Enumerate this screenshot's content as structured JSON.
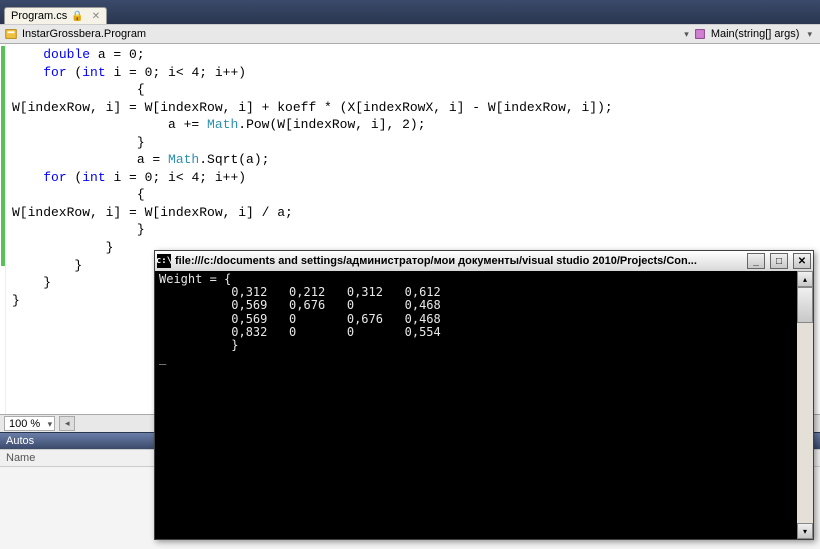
{
  "tab": {
    "label": "Program.cs",
    "locked": true
  },
  "breadcrumb": {
    "namespace": "InstarGrossbera.Program",
    "method": "Main(string[] args)"
  },
  "code": {
    "lines": [
      {
        "indent": 1,
        "tokens": [
          [
            "kw",
            "double"
          ],
          [
            "",
            " a = 0;"
          ]
        ]
      },
      {
        "indent": 1,
        "tokens": [
          [
            "kw",
            "for"
          ],
          [
            "",
            " ("
          ],
          [
            "kw",
            "int"
          ],
          [
            "",
            " i = 0; i< 4; i++)"
          ]
        ]
      },
      {
        "indent": 4,
        "tokens": [
          [
            "",
            "{"
          ]
        ]
      },
      {
        "indent": 0,
        "tokens": [
          [
            "",
            "W[indexRow, i] = W[indexRow, i] + koeff * (X[indexRowX, i] - W[indexRow, i]);"
          ]
        ]
      },
      {
        "indent": 5,
        "tokens": [
          [
            "",
            "a += "
          ],
          [
            "cls",
            "Math"
          ],
          [
            "",
            ".Pow(W[indexRow, i], 2);"
          ]
        ]
      },
      {
        "indent": 4,
        "tokens": [
          [
            "",
            "}"
          ]
        ]
      },
      {
        "indent": 4,
        "tokens": [
          [
            "",
            "a = "
          ],
          [
            "cls",
            "Math"
          ],
          [
            "",
            ".Sqrt(a);"
          ]
        ]
      },
      {
        "indent": 1,
        "tokens": [
          [
            "kw",
            "for"
          ],
          [
            "",
            " ("
          ],
          [
            "kw",
            "int"
          ],
          [
            "",
            " i = 0; i< 4; i++)"
          ]
        ]
      },
      {
        "indent": 4,
        "tokens": [
          [
            "",
            "{"
          ]
        ]
      },
      {
        "indent": 0,
        "tokens": [
          [
            "",
            "W[indexRow, i] = W[indexRow, i] / a;"
          ]
        ]
      },
      {
        "indent": 4,
        "tokens": [
          [
            "",
            "}"
          ]
        ]
      },
      {
        "indent": 3,
        "tokens": [
          [
            "",
            "}"
          ]
        ]
      },
      {
        "indent": 2,
        "tokens": [
          [
            "",
            "}"
          ]
        ]
      },
      {
        "indent": 1,
        "tokens": [
          [
            "",
            "}"
          ]
        ]
      },
      {
        "indent": 0,
        "tokens": [
          [
            "",
            "}"
          ]
        ]
      }
    ]
  },
  "zoom": {
    "value": "100 %"
  },
  "autos": {
    "panel_title": "Autos",
    "col_name": "Name"
  },
  "console": {
    "title_prefix": "c:\\",
    "title": "file:///c:/documents and settings/администратор/мои документы/visual studio 2010/Projects/Con...",
    "output_header": "Weight = {",
    "rows": [
      [
        "0,312",
        "0,212",
        "0,312",
        "0,612"
      ],
      [
        "0,569",
        "0,676",
        "0",
        "0,468"
      ],
      [
        "0,569",
        "0",
        "0,676",
        "0,468"
      ],
      [
        "0,832",
        "0",
        "0",
        "0,554"
      ]
    ],
    "output_footer": "}",
    "cursor": "_"
  }
}
